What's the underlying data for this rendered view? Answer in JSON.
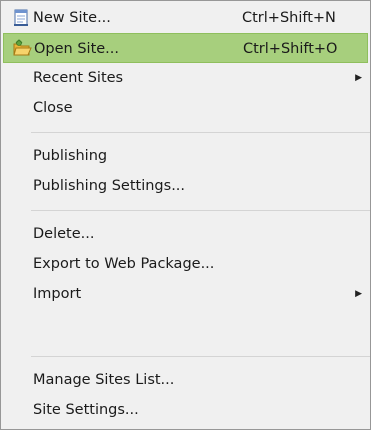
{
  "menu": {
    "items": [
      {
        "label": "New Site...",
        "shortcut": "Ctrl+Shift+N",
        "icon": "new-site-icon"
      },
      {
        "label": "Open Site...",
        "shortcut": "Ctrl+Shift+O",
        "icon": "open-folder-icon",
        "highlighted": true
      },
      {
        "label": "Recent Sites",
        "submenu": true
      },
      {
        "label": "Close"
      },
      {
        "label": "Publishing"
      },
      {
        "label": "Publishing Settings..."
      },
      {
        "label": "Delete..."
      },
      {
        "label": "Export to Web Package..."
      },
      {
        "label": "Import",
        "submenu": true
      },
      {
        "label": "Manage Sites List..."
      },
      {
        "label": "Site Settings..."
      }
    ],
    "submenu_arrow": "▶",
    "highlight_color": "#a7cf7d"
  }
}
